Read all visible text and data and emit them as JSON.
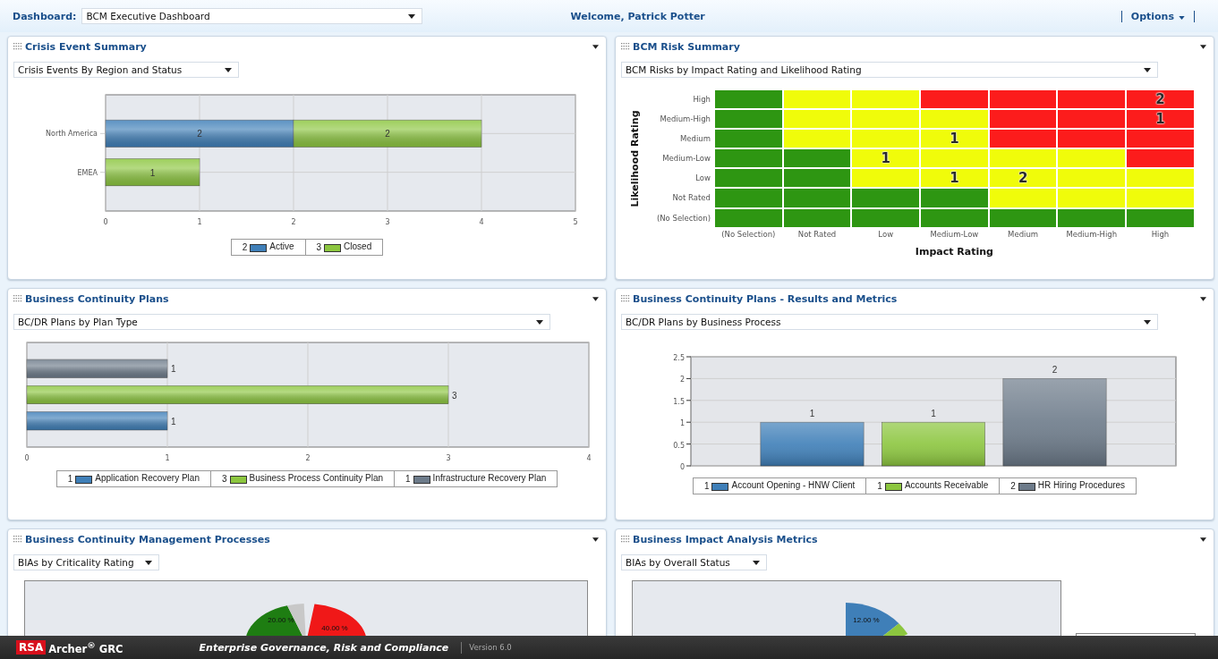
{
  "top_bar": {
    "dashboard_label": "Dashboard:",
    "dashboard_select": "BCM Executive Dashboard",
    "welcome": "Welcome, Patrick Potter",
    "options": "Options"
  },
  "panels": [
    {
      "kind": "bar",
      "title": "Crisis Event Summary",
      "report": "Crisis Events By Region and Status",
      "chart_data": {
        "type": "bar",
        "orientation": "horizontal",
        "stacked": true,
        "categories": [
          "North America",
          "EMEA"
        ],
        "series": [
          {
            "name": "Active",
            "color": "#3f7fb8",
            "values": [
              2,
              null
            ]
          },
          {
            "name": "Closed",
            "color": "#8cc63f",
            "values": [
              2,
              1
            ]
          }
        ],
        "xlim": [
          0,
          5
        ],
        "xticks": [
          0,
          1,
          2,
          3,
          4,
          5
        ],
        "grid": true,
        "data_labels": true
      },
      "legend_counts": [
        "2",
        "3"
      ]
    },
    {
      "kind": "matrix",
      "title": "BCM Risk Summary",
      "report": "BCM Risks by Impact Rating and Likelihood Rating",
      "risk_matrix": {
        "ylabel": "Likelihood Rating",
        "xlabel": "Impact Rating",
        "x_axis_labels": [
          "(No Selection)",
          "Not Rated",
          "Low",
          "Medium-Low",
          "Medium",
          "Medium-High",
          "High"
        ],
        "rows": [
          {
            "label": "High",
            "cells": [
              {
                "color": "#2e9612"
              },
              {
                "color": "#f0fc0a"
              },
              {
                "color": "#f0fc0a"
              },
              {
                "color": "#fc1c1c"
              },
              {
                "color": "#fc1c1c"
              },
              {
                "color": "#fc1c1c"
              },
              {
                "color": "#fc1c1c",
                "count": "2"
              }
            ]
          },
          {
            "label": "Medium-High",
            "cells": [
              {
                "color": "#2e9612"
              },
              {
                "color": "#f0fc0a"
              },
              {
                "color": "#f0fc0a"
              },
              {
                "color": "#f0fc0a"
              },
              {
                "color": "#fc1c1c"
              },
              {
                "color": "#fc1c1c"
              },
              {
                "color": "#fc1c1c",
                "count": "1"
              }
            ]
          },
          {
            "label": "Medium",
            "cells": [
              {
                "color": "#2e9612"
              },
              {
                "color": "#f0fc0a"
              },
              {
                "color": "#f0fc0a"
              },
              {
                "color": "#f0fc0a",
                "count": "1"
              },
              {
                "color": "#fc1c1c"
              },
              {
                "color": "#fc1c1c"
              },
              {
                "color": "#fc1c1c"
              }
            ]
          },
          {
            "label": "Medium-Low",
            "cells": [
              {
                "color": "#2e9612"
              },
              {
                "color": "#2e9612"
              },
              {
                "color": "#f0fc0a",
                "count": "1"
              },
              {
                "color": "#f0fc0a"
              },
              {
                "color": "#f0fc0a"
              },
              {
                "color": "#f0fc0a"
              },
              {
                "color": "#fc1c1c"
              }
            ]
          },
          {
            "label": "Low",
            "cells": [
              {
                "color": "#2e9612"
              },
              {
                "color": "#2e9612"
              },
              {
                "color": "#f0fc0a"
              },
              {
                "color": "#f0fc0a",
                "count": "1"
              },
              {
                "color": "#f0fc0a",
                "count": "2"
              },
              {
                "color": "#f0fc0a"
              },
              {
                "color": "#f0fc0a"
              }
            ]
          },
          {
            "label": "Not Rated",
            "cells": [
              {
                "color": "#2e9612"
              },
              {
                "color": "#2e9612"
              },
              {
                "color": "#2e9612"
              },
              {
                "color": "#2e9612"
              },
              {
                "color": "#f0fc0a"
              },
              {
                "color": "#f0fc0a"
              },
              {
                "color": "#f0fc0a"
              }
            ]
          },
          {
            "label": "(No Selection)",
            "cells": [
              {
                "color": "#2e9612"
              },
              {
                "color": "#2e9612"
              },
              {
                "color": "#2e9612"
              },
              {
                "color": "#2e9612"
              },
              {
                "color": "#2e9612"
              },
              {
                "color": "#2e9612"
              },
              {
                "color": "#2e9612"
              }
            ]
          }
        ]
      }
    },
    {
      "kind": "bar",
      "title": "Business Continuity Plans",
      "report": "BC/DR Plans by Plan Type",
      "chart_data": {
        "type": "bar",
        "orientation": "horizontal",
        "stacked": true,
        "series": [
          {
            "name": "Application Recovery Plan",
            "color": "#3f7fb8",
            "values": [
              null,
              null,
              1
            ]
          },
          {
            "name": "Business Process Continuity Plan",
            "color": "#8cc63f",
            "values": [
              null,
              3,
              null
            ]
          },
          {
            "name": "Infrastructure Recovery Plan",
            "color": "#6d7b8a",
            "values": [
              1,
              null,
              null
            ]
          }
        ],
        "xlim": [
          0,
          4
        ],
        "xticks": [
          0,
          1,
          2,
          3,
          4
        ],
        "grid": true,
        "data_labels": true
      },
      "legend_counts": [
        "1",
        "3",
        "1"
      ]
    },
    {
      "kind": "bar",
      "title": "Business Continuity Plans - Results and Metrics",
      "report": "BC/DR Plans by Business Process",
      "chart_data": {
        "type": "bar",
        "orientation": "vertical",
        "stacked": true,
        "series": [
          {
            "name": "Account Opening - HNW Client",
            "color": "#3f7fb8",
            "values": [
              1,
              null,
              null
            ]
          },
          {
            "name": "Accounts Receivable",
            "color": "#8cc63f",
            "values": [
              null,
              1,
              null
            ]
          },
          {
            "name": "HR Hiring Procedures",
            "color": "#6d7b8a",
            "values": [
              null,
              null,
              2
            ]
          }
        ],
        "ylim": [
          0,
          2.5
        ],
        "yticks": [
          0,
          0.5,
          1,
          1.5,
          2,
          2.5
        ],
        "grid": true,
        "data_labels": true
      },
      "legend_counts": [
        "1",
        "1",
        "2"
      ]
    },
    {
      "kind": "pie",
      "title": "Business Continuity Management Processes",
      "report": "BIAs by Criticality Rating",
      "slice_labels": [
        "20.00 %",
        "40.00 %"
      ]
    },
    {
      "kind": "pie",
      "title": "Business Impact Analysis Metrics",
      "report": "BIAs by Overall Status",
      "slice_labels": [
        "12.00 %"
      ]
    }
  ],
  "footer": {
    "logo": "RSA",
    "product": "Archer$^{®}$ GRC",
    "tagline": "Enterprise Governance, Risk and Compliance",
    "version": "Version 6.0"
  }
}
